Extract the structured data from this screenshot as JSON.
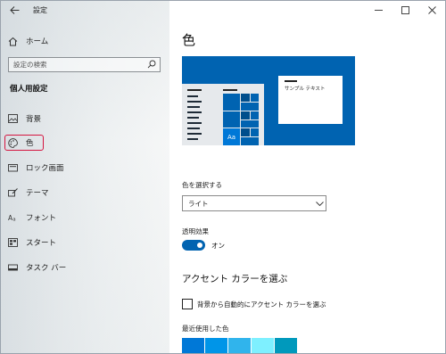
{
  "window": {
    "title": "設定"
  },
  "nav": {
    "back_icon": "back-arrow-icon",
    "home_label": "ホーム"
  },
  "search": {
    "placeholder": "設定の検索",
    "value": ""
  },
  "sidebar": {
    "heading": "個人用設定",
    "items": [
      {
        "label": "背景",
        "icon": "picture-icon"
      },
      {
        "label": "色",
        "icon": "palette-icon",
        "selected": true
      },
      {
        "label": "ロック画面",
        "icon": "lock-screen-icon"
      },
      {
        "label": "テーマ",
        "icon": "theme-brush-icon"
      },
      {
        "label": "フォント",
        "icon": "font-icon"
      },
      {
        "label": "スタート",
        "icon": "start-grid-icon"
      },
      {
        "label": "タスク バー",
        "icon": "taskbar-icon"
      }
    ]
  },
  "caption": {
    "minimize": "minimize-icon",
    "maximize": "maximize-icon",
    "close": "close-icon"
  },
  "page": {
    "title": "色",
    "preview": {
      "sample_text": "サンプル テキスト",
      "tile_label": "Aa"
    },
    "mode": {
      "label": "色を選択する",
      "value": "ライト"
    },
    "transparency": {
      "label": "透明効果",
      "state": "オン",
      "on": true
    },
    "accent": {
      "heading": "アクセント カラーを選ぶ",
      "auto_label": "背景から自動的にアクセント カラーを選ぶ",
      "auto_checked": false,
      "recent_label": "最近使用した色",
      "recent_colors": [
        "#0078d7",
        "#0095e8",
        "#30b4ec",
        "#7ef0ff",
        "#0099bc"
      ]
    }
  },
  "colors": {
    "accent": "#0063b1",
    "highlight_border": "#d4143f"
  }
}
